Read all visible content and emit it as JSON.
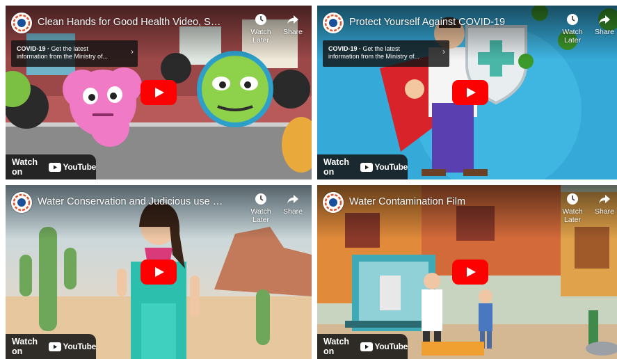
{
  "colors": {
    "youtube_red": "#ff0000",
    "overlay": "#171717"
  },
  "common": {
    "watch_later": "Watch Later",
    "share": "Share",
    "watch_on": "Watch on",
    "youtube": "YouTube"
  },
  "videos": [
    {
      "title": "Clean Hands for Good Health Video, Soa...",
      "info_card": {
        "label": "COVID-19 ·",
        "text": "Get the latest information from the Ministry of..."
      }
    },
    {
      "title": "Protect Yourself Against COVID-19",
      "info_card": {
        "label": "COVID-19 ·",
        "text": "Get the latest information from the Ministry of..."
      }
    },
    {
      "title": "Water Conservation and Judicious use of..."
    },
    {
      "title": "Water Contamination Film"
    }
  ]
}
